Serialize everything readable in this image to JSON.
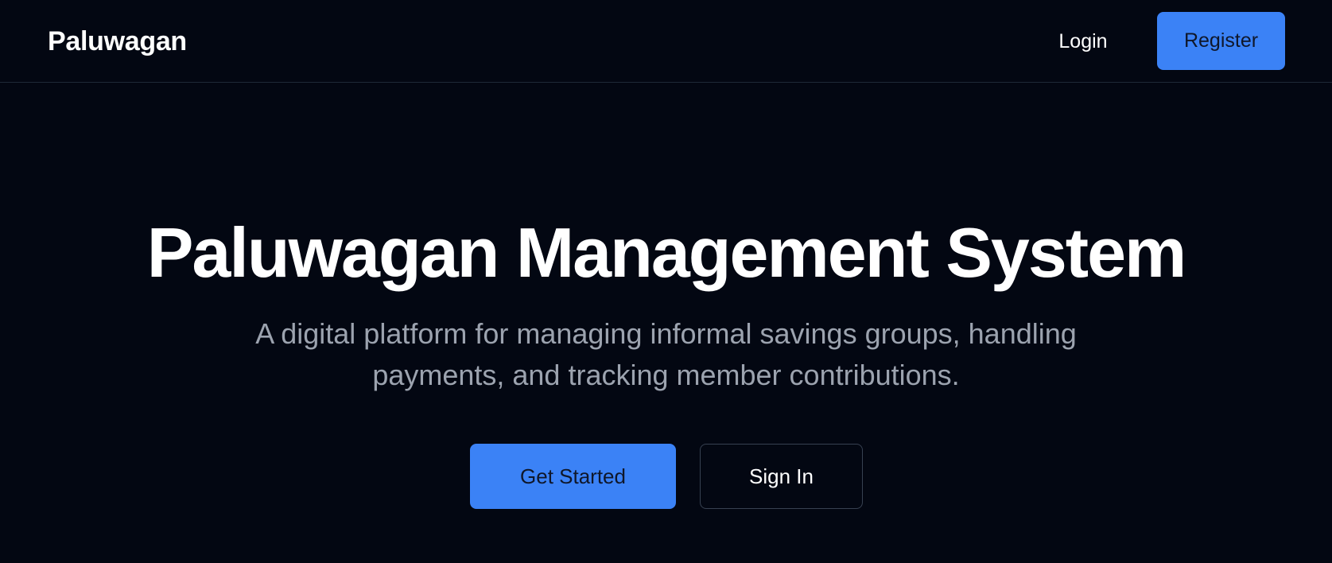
{
  "navbar": {
    "brand": "Paluwagan",
    "login_label": "Login",
    "register_label": "Register"
  },
  "hero": {
    "title": "Paluwagan Management System",
    "subtitle": "A digital platform for managing informal savings groups, handling payments, and tracking member contributions.",
    "primary_button": "Get Started",
    "secondary_button": "Sign In"
  },
  "colors": {
    "background": "#030712",
    "accent": "#3b82f6",
    "muted_text": "#9ca3af",
    "border": "#1f2937"
  }
}
